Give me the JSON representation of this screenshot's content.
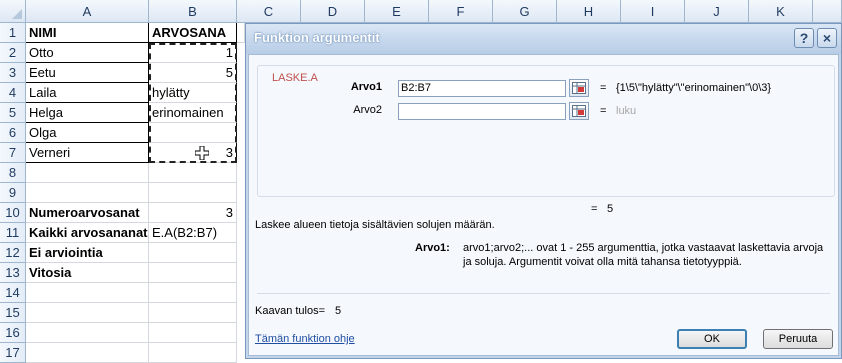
{
  "sheet": {
    "columns": [
      "A",
      "B",
      "C",
      "D",
      "E",
      "F",
      "G",
      "H",
      "I",
      "J",
      "K"
    ],
    "rows": [
      "1",
      "2",
      "3",
      "4",
      "5",
      "6",
      "7",
      "8",
      "9",
      "10",
      "11",
      "12",
      "13",
      "14",
      "15",
      "16",
      "17"
    ],
    "cells": {
      "a1": "NIMI",
      "b1": "ARVOSANA",
      "a2": "Otto",
      "b2": "1",
      "a3": "Eetu",
      "b3": "5",
      "a4": "Laila",
      "b4": "hylätty",
      "a5": "Helga",
      "b5": "erinomainen",
      "a6": "Olga",
      "b6": "",
      "a7": "Verneri",
      "b7": "3",
      "a10": "Numeroarvosanat",
      "b10": "3",
      "a11": "Kaikki arvosananat",
      "b11": "E.A(B2:B7)",
      "a12": "Ei arviointia",
      "a13": "Vitosia"
    }
  },
  "dialog": {
    "title": "Funktion argumentit",
    "help_label": "?",
    "close_label": "×",
    "function_name": "LASKE.A",
    "arg1_label": "Arvo1",
    "arg1_value": "B2:B7",
    "arg1_result": "{1\\5\\\"hylätty\"\\\"erinomainen\"\\0\\3}",
    "arg2_label": "Arvo2",
    "arg2_value": "",
    "arg2_result": "luku",
    "equals": "=",
    "overall_result": "5",
    "description": "Laskee alueen tietoja sisältävien solujen määrän.",
    "arg_help_label": "Arvo1:",
    "arg_help_line1": "arvo1;arvo2;... ovat 1 - 255 argumenttia, jotka vastaavat laskettavia arvoja",
    "arg_help_line2": "ja soluja. Argumentit voivat olla mitä tahansa tietotyyppiä.",
    "formula_result_label": "Kaavan tulos=",
    "formula_result_value": "5",
    "help_link": "Tämän funktion ohje",
    "ok_label": "OK",
    "cancel_label": "Peruuta"
  },
  "colors": {
    "accent_red": "#c0504d",
    "link_blue": "#1f4ea3",
    "title_bar": "#b7cce6"
  }
}
